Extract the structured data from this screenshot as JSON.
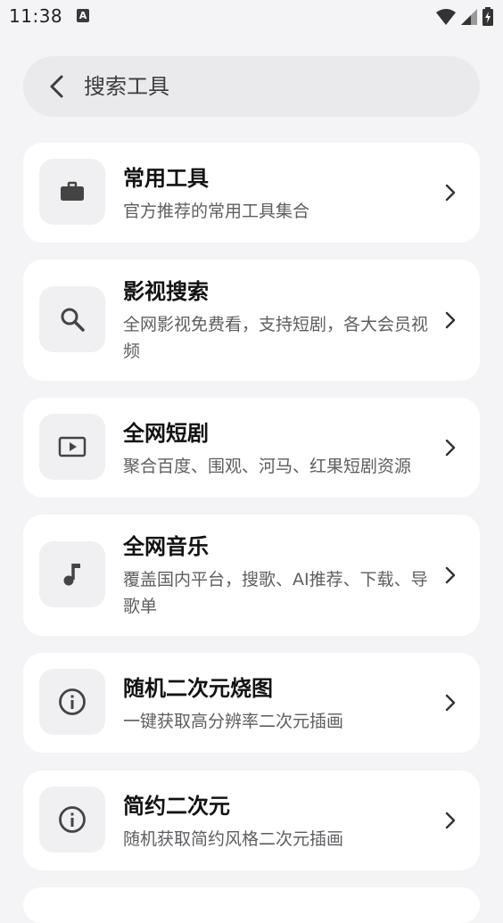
{
  "status_bar": {
    "time": "11:38",
    "notification_badge": "A"
  },
  "search": {
    "back_icon": "chevron-left-icon",
    "label": "搜索工具"
  },
  "tools": [
    {
      "title": "常用工具",
      "desc": "官方推荐的常用工具集合",
      "icon": "briefcase-icon"
    },
    {
      "title": "影视搜索",
      "desc": "全网影视免费看，支持短剧，各大会员视频",
      "icon": "search-icon"
    },
    {
      "title": "全网短剧",
      "desc": "聚合百度、围观、河马、红果短剧资源",
      "icon": "video-play-icon"
    },
    {
      "title": "全网音乐",
      "desc": "覆盖国内平台，搜歌、AI推荐、下载、导歌单",
      "icon": "music-note-icon"
    },
    {
      "title": "随机二次元烧图",
      "desc": "一键获取高分辨率二次元插画",
      "icon": "info-icon"
    },
    {
      "title": "简约二次元",
      "desc": "随机获取简约风格二次元插画",
      "icon": "info-icon"
    }
  ]
}
